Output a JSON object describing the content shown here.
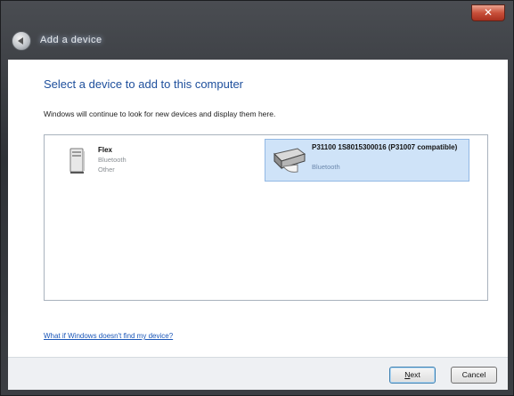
{
  "window": {
    "title": "Add a device",
    "close_label": "✕"
  },
  "main": {
    "heading": "Select a device to add to this computer",
    "description": "Windows will continue to look for new devices and display them here.",
    "devices": [
      {
        "name": "Flex",
        "type": "Bluetooth",
        "category": "Other",
        "icon": "computer-tower-icon",
        "selected": false
      },
      {
        "name": "P31100 1S8015300016   (P31007 compatible)",
        "type": "Bluetooth",
        "icon": "printer-icon",
        "selected": true
      }
    ],
    "help_link": "What if Windows doesn't find my device?"
  },
  "footer": {
    "next_mnemonic": "N",
    "next_rest": "ext",
    "cancel_label": "Cancel"
  },
  "colors": {
    "heading": "#1e4f9c",
    "selection_bg": "#cfe3f8",
    "close_button": "#c9503a"
  }
}
